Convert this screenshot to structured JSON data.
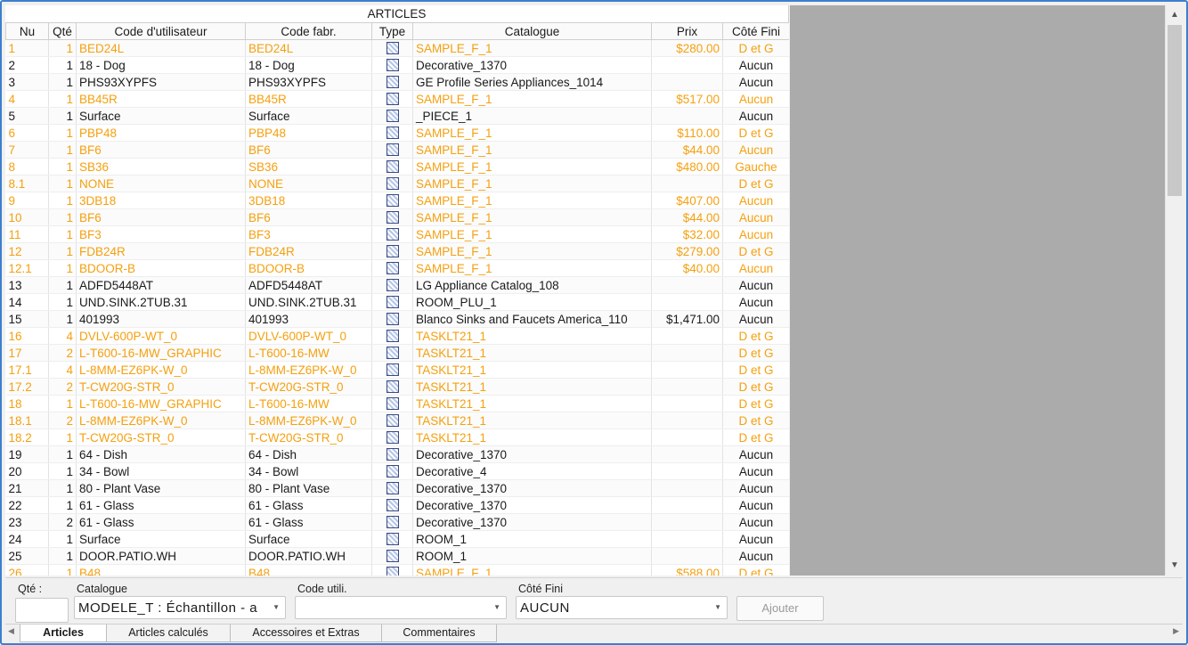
{
  "table": {
    "title": "ARTICLES",
    "headers": [
      "Nu",
      "Qté",
      "Code d'utilisateur",
      "Code fabr.",
      "Type",
      "Catalogue",
      "Prix",
      "Côté Fini"
    ],
    "rows": [
      {
        "nu": "1",
        "qte": "1",
        "code": "BED24L",
        "fabr": "BED24L",
        "catalogue": "SAMPLE_F_1",
        "prix": "$280.00",
        "cote": "D et G",
        "highlight": true
      },
      {
        "nu": "2",
        "qte": "1",
        "code": "18 - Dog",
        "fabr": "18 - Dog",
        "catalogue": "Decorative_1370",
        "prix": "",
        "cote": "Aucun",
        "highlight": false
      },
      {
        "nu": "3",
        "qte": "1",
        "code": "PHS93XYPFS",
        "fabr": "PHS93XYPFS",
        "catalogue": "GE Profile Series Appliances_1014",
        "prix": "",
        "cote": "Aucun",
        "highlight": false
      },
      {
        "nu": "4",
        "qte": "1",
        "code": "BB45R",
        "fabr": "BB45R",
        "catalogue": "SAMPLE_F_1",
        "prix": "$517.00",
        "cote": "Aucun",
        "highlight": true
      },
      {
        "nu": "5",
        "qte": "1",
        "code": "Surface",
        "fabr": "Surface",
        "catalogue": "_PIECE_1",
        "prix": "",
        "cote": "Aucun",
        "highlight": false
      },
      {
        "nu": "6",
        "qte": "1",
        "code": "PBP48",
        "fabr": "PBP48",
        "catalogue": "SAMPLE_F_1",
        "prix": "$110.00",
        "cote": "D et G",
        "highlight": true
      },
      {
        "nu": "7",
        "qte": "1",
        "code": "BF6",
        "fabr": "BF6",
        "catalogue": "SAMPLE_F_1",
        "prix": "$44.00",
        "cote": "Aucun",
        "highlight": true
      },
      {
        "nu": "8",
        "qte": "1",
        "code": "SB36",
        "fabr": "SB36",
        "catalogue": "SAMPLE_F_1",
        "prix": "$480.00",
        "cote": "Gauche",
        "highlight": true
      },
      {
        "nu": "8.1",
        "qte": "1",
        "code": "NONE",
        "fabr": "NONE",
        "catalogue": "SAMPLE_F_1",
        "prix": "",
        "cote": "D et G",
        "highlight": true
      },
      {
        "nu": "9",
        "qte": "1",
        "code": "3DB18",
        "fabr": "3DB18",
        "catalogue": "SAMPLE_F_1",
        "prix": "$407.00",
        "cote": "Aucun",
        "highlight": true
      },
      {
        "nu": "10",
        "qte": "1",
        "code": "BF6",
        "fabr": "BF6",
        "catalogue": "SAMPLE_F_1",
        "prix": "$44.00",
        "cote": "Aucun",
        "highlight": true
      },
      {
        "nu": "11",
        "qte": "1",
        "code": "BF3",
        "fabr": "BF3",
        "catalogue": "SAMPLE_F_1",
        "prix": "$32.00",
        "cote": "Aucun",
        "highlight": true
      },
      {
        "nu": "12",
        "qte": "1",
        "code": "FDB24R",
        "fabr": "FDB24R",
        "catalogue": "SAMPLE_F_1",
        "prix": "$279.00",
        "cote": "D et G",
        "highlight": true
      },
      {
        "nu": "12.1",
        "qte": "1",
        "code": "BDOOR-B",
        "fabr": "BDOOR-B",
        "catalogue": "SAMPLE_F_1",
        "prix": "$40.00",
        "cote": "Aucun",
        "highlight": true
      },
      {
        "nu": "13",
        "qte": "1",
        "code": "ADFD5448AT",
        "fabr": "ADFD5448AT",
        "catalogue": "LG Appliance Catalog_108",
        "prix": "",
        "cote": "Aucun",
        "highlight": false
      },
      {
        "nu": "14",
        "qte": "1",
        "code": "UND.SINK.2TUB.31",
        "fabr": "UND.SINK.2TUB.31",
        "catalogue": "ROOM_PLU_1",
        "prix": "",
        "cote": "Aucun",
        "highlight": false
      },
      {
        "nu": "15",
        "qte": "1",
        "code": "401993",
        "fabr": "401993",
        "catalogue": "Blanco Sinks and Faucets America_110",
        "prix": "$1,471.00",
        "cote": "Aucun",
        "highlight": false
      },
      {
        "nu": "16",
        "qte": "4",
        "code": "DVLV-600P-WT_0",
        "fabr": "DVLV-600P-WT_0",
        "catalogue": "TASKLT21_1",
        "prix": "",
        "cote": "D et G",
        "highlight": true
      },
      {
        "nu": "17",
        "qte": "2",
        "code": "L-T600-16-MW_GRAPHIC",
        "fabr": "L-T600-16-MW",
        "catalogue": "TASKLT21_1",
        "prix": "",
        "cote": "D et G",
        "highlight": true
      },
      {
        "nu": "17.1",
        "qte": "4",
        "code": "L-8MM-EZ6PK-W_0",
        "fabr": "L-8MM-EZ6PK-W_0",
        "catalogue": "TASKLT21_1",
        "prix": "",
        "cote": "D et G",
        "highlight": true
      },
      {
        "nu": "17.2",
        "qte": "2",
        "code": "T-CW20G-STR_0",
        "fabr": "T-CW20G-STR_0",
        "catalogue": "TASKLT21_1",
        "prix": "",
        "cote": "D et G",
        "highlight": true
      },
      {
        "nu": "18",
        "qte": "1",
        "code": "L-T600-16-MW_GRAPHIC",
        "fabr": "L-T600-16-MW",
        "catalogue": "TASKLT21_1",
        "prix": "",
        "cote": "D et G",
        "highlight": true
      },
      {
        "nu": "18.1",
        "qte": "2",
        "code": "L-8MM-EZ6PK-W_0",
        "fabr": "L-8MM-EZ6PK-W_0",
        "catalogue": "TASKLT21_1",
        "prix": "",
        "cote": "D et G",
        "highlight": true
      },
      {
        "nu": "18.2",
        "qte": "1",
        "code": "T-CW20G-STR_0",
        "fabr": "T-CW20G-STR_0",
        "catalogue": "TASKLT21_1",
        "prix": "",
        "cote": "D et G",
        "highlight": true
      },
      {
        "nu": "19",
        "qte": "1",
        "code": "64 - Dish",
        "fabr": "64 - Dish",
        "catalogue": "Decorative_1370",
        "prix": "",
        "cote": "Aucun",
        "highlight": false
      },
      {
        "nu": "20",
        "qte": "1",
        "code": "34 - Bowl",
        "fabr": "34 - Bowl",
        "catalogue": "Decorative_4",
        "prix": "",
        "cote": "Aucun",
        "highlight": false
      },
      {
        "nu": "21",
        "qte": "1",
        "code": "80 - Plant Vase",
        "fabr": "80 - Plant Vase",
        "catalogue": "Decorative_1370",
        "prix": "",
        "cote": "Aucun",
        "highlight": false
      },
      {
        "nu": "22",
        "qte": "1",
        "code": "61 - Glass",
        "fabr": "61 - Glass",
        "catalogue": "Decorative_1370",
        "prix": "",
        "cote": "Aucun",
        "highlight": false
      },
      {
        "nu": "23",
        "qte": "2",
        "code": "61 - Glass",
        "fabr": "61 - Glass",
        "catalogue": "Decorative_1370",
        "prix": "",
        "cote": "Aucun",
        "highlight": false
      },
      {
        "nu": "24",
        "qte": "1",
        "code": "Surface",
        "fabr": "Surface",
        "catalogue": "ROOM_1",
        "prix": "",
        "cote": "Aucun",
        "highlight": false
      },
      {
        "nu": "25",
        "qte": "1",
        "code": "DOOR.PATIO.WH",
        "fabr": "DOOR.PATIO.WH",
        "catalogue": "ROOM_1",
        "prix": "",
        "cote": "Aucun",
        "highlight": false
      },
      {
        "nu": "26",
        "qte": "1",
        "code": "B48",
        "fabr": "B48",
        "catalogue": "SAMPLE_F_1",
        "prix": "$588.00",
        "cote": "D et G",
        "highlight": true
      }
    ]
  },
  "form": {
    "qte_label": "Qté :",
    "qte_value": "",
    "catalogue_label": "Catalogue",
    "catalogue_value": "MODELE_T : Échantillon - a",
    "code_label": "Code utili.",
    "code_value": "",
    "cote_label": "Côté Fini",
    "cote_value": "AUCUN",
    "add_button": "Ajouter"
  },
  "tabs": [
    {
      "label": "Articles",
      "active": true
    },
    {
      "label": "Articles calculés",
      "active": false
    },
    {
      "label": "Accessoires et Extras",
      "active": false
    },
    {
      "label": "Commentaires",
      "active": false
    }
  ],
  "icons": {
    "type_icon": "catalog-item-icon",
    "scroll_up": "arrow-up-icon",
    "scroll_down": "arrow-down-icon",
    "dropdown": "chevron-down-icon",
    "tab_left": "arrow-left-icon",
    "tab_right": "arrow-right-icon"
  },
  "colors": {
    "highlight_text": "#f5a00f",
    "window_border": "#3c7fcf",
    "empty_area": "#ababab"
  }
}
